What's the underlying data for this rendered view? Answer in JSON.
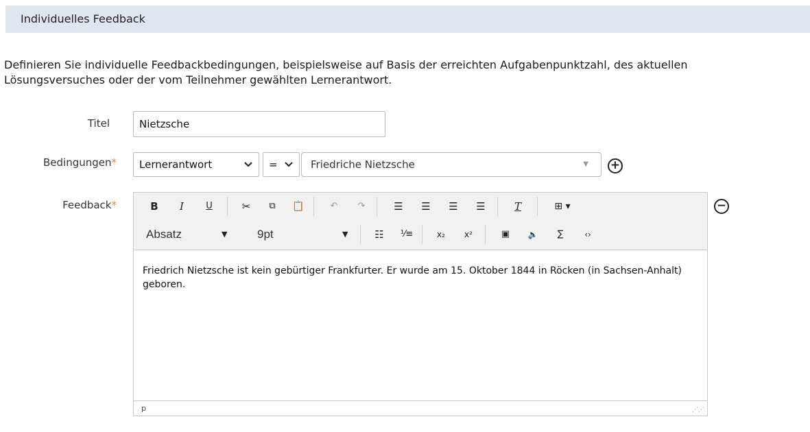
{
  "section": {
    "title": "Individuelles Feedback"
  },
  "intro": {
    "line1": "Definieren Sie individuelle Feedbackbedingungen, beispielsweise auf Basis der erreichten Aufgabenpunktzahl, des aktuellen",
    "line2": "Lösungsversuches oder der vom Teilnehmer gewählten Lernerantwort."
  },
  "form": {
    "title_label": "Titel",
    "title_value": "Nietzsche",
    "conditions_label": "Bedingungen",
    "condition_type": "Lernerantwort",
    "condition_operator": "=",
    "condition_value": "Friedriche Nietzsche",
    "feedback_label": "Feedback",
    "required_mark": "*"
  },
  "editor": {
    "toolbar": {
      "bold": "B",
      "italic": "I",
      "underline": "U",
      "format_select": "Absatz",
      "size_select": "9pt"
    },
    "content": "Friedrich Nietzsche ist kein gebürtiger Frankfurter. Er wurde am 15. Oktober 1844 in Röcken (in Sachsen-Anhalt) geboren.",
    "status_path": "p"
  },
  "icons": [
    "plus-circle-icon",
    "minus-circle-icon",
    "cut-icon",
    "copy-icon",
    "paste-icon",
    "undo-icon",
    "redo-icon",
    "align-left-icon",
    "align-center-icon",
    "align-right-icon",
    "align-justify-icon",
    "clear-format-icon",
    "table-icon",
    "bullet-list-icon",
    "numbered-list-icon",
    "subscript-icon",
    "superscript-icon",
    "image-icon",
    "audio-icon",
    "sigma-icon",
    "code-icon"
  ],
  "colors": {
    "header_bg": "#dfe6ee",
    "required": "#e8833a",
    "toolbar_bg": "#f1f1f1"
  }
}
